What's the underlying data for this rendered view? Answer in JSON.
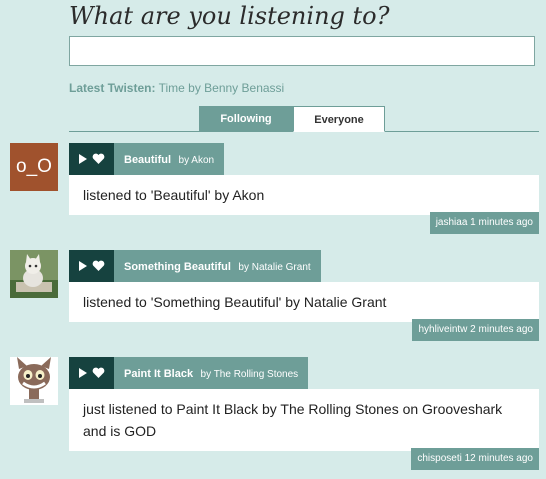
{
  "header": {
    "title": "What are you listening to?",
    "status_input_value": ""
  },
  "latest": {
    "label": "Latest Twisten:",
    "text": "Time by Benny Benassi"
  },
  "tabs": [
    {
      "label": "Following",
      "active": false
    },
    {
      "label": "Everyone",
      "active": true
    }
  ],
  "feed": [
    {
      "avatar_text": "o_O",
      "song": "Beautiful",
      "by": "by Akon",
      "status": "listened to 'Beautiful' by Akon",
      "user": "jashiaa",
      "time": "1 minutes ago"
    },
    {
      "avatar_text": "",
      "song": "Something Beautiful",
      "by": "by Natalie Grant",
      "status": "listened to 'Something Beautiful' by Natalie Grant",
      "user": "hyhliveintw",
      "time": "2 minutes ago"
    },
    {
      "avatar_text": "",
      "song": "Paint It Black",
      "by": "by The Rolling Stones",
      "status": "just listened to Paint It Black by The Rolling Stones on Grooveshark and is GOD",
      "user": "chisposeti",
      "time": "12 minutes ago"
    }
  ],
  "icons": {
    "play": "play-icon",
    "favorite": "heart-icon"
  },
  "colors": {
    "background": "#d6ebe9",
    "accent": "#6e9e98",
    "dark": "#16423f"
  }
}
